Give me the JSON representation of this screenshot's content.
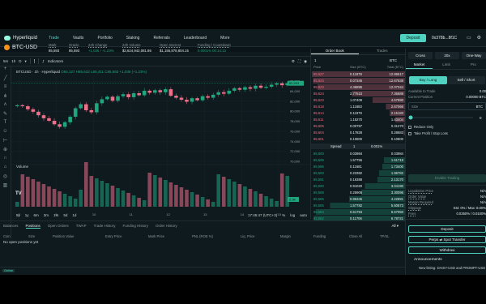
{
  "nav": {
    "logo": "Hyperliquid",
    "links": [
      "Trade",
      "Vaults",
      "Portfolio",
      "Staking",
      "Referrals",
      "Leaderboard",
      "More"
    ],
    "active": "Trade",
    "connect_label": "Deposit",
    "account": "0x378b...8f1C",
    "icons": [
      "display-icon",
      "gear-icon",
      "globe-icon"
    ]
  },
  "ticker": {
    "symbol": "BTC-USD",
    "stats": [
      {
        "label": "Mark",
        "value": "85,593"
      },
      {
        "label": "Oracle",
        "value": "85,593"
      },
      {
        "label": "24h Change",
        "value": "+1,036 / +1.23%"
      },
      {
        "label": "24h Volume",
        "value": "$3,624,942,081.86"
      },
      {
        "label": "Open Interest",
        "value": "$1,155,878,804.15"
      },
      {
        "label": "Funding / Countdown",
        "value": "0.0001%  00:14:13"
      }
    ]
  },
  "chart_toolbar": {
    "intervals": [
      "5m",
      "1h",
      "D"
    ],
    "indicators_label": "Indicators"
  },
  "chart_title": "BTCUSD · 1h · Hyperliquid",
  "chart_ohlc": "O84,127 H85,632 L85,411 C85,593 +1,036 (+1.23%)",
  "volume_label": "Volume",
  "chart_bottom": {
    "ranges": [
      "5y",
      "1y",
      "6m",
      "3m",
      "1m",
      "5d",
      "1d"
    ],
    "time": "17:45:47 (UTC+3)",
    "scale_labels": [
      "%",
      "log",
      "auto"
    ]
  },
  "chart_data": {
    "type": "candlestick",
    "x_ticks": [
      "8",
      "9",
      "10",
      "11",
      "12",
      "13",
      "14",
      "15"
    ],
    "y_ticks": [
      "86,000",
      "84,000",
      "82,000",
      "80,000",
      "78,000",
      "76,000",
      "74,000",
      "72,000",
      "70,000"
    ],
    "last_price_label": "85,593",
    "volume_label_value": "2.3K",
    "y_range": [
      70000,
      87000
    ],
    "close_series": [
      81200,
      81000,
      80400,
      79900,
      79200,
      78600,
      78100,
      77400,
      76900,
      77800,
      78900,
      80600,
      81400,
      80200,
      79800,
      81600,
      82400,
      82900,
      82100,
      83000,
      83400,
      82800,
      83600,
      83200,
      84100,
      83700,
      84200,
      83800,
      84400,
      83100,
      82700,
      82300,
      81900,
      82600,
      82200,
      83000,
      82700,
      83300,
      83800,
      83500,
      84100,
      84600,
      84300,
      84800,
      84500,
      85100,
      84700,
      84900,
      85300,
      85600,
      85200,
      85593
    ]
  },
  "orderbook": {
    "tabs": [
      "Order Book",
      "Trades"
    ],
    "active_tab": "Order Book",
    "tick_size": "1",
    "unit": "BTC",
    "columns": [
      "Price",
      "Size (BTC)",
      "Total (BTC)"
    ],
    "asks": [
      [
        "85,627",
        "0.11879",
        "12.86517"
      ],
      [
        "85,624",
        "0.07345",
        "12.67638"
      ],
      [
        "85,623",
        "4.46895",
        "12.07344"
      ],
      [
        "85,624",
        "2.77510",
        "7.35689"
      ],
      [
        "85,623",
        "1.07409",
        "4.57990"
      ],
      [
        "85,618",
        "1.11883",
        "2.67066"
      ],
      [
        "85,614",
        "0.11979",
        "2.15183"
      ],
      [
        "85,611",
        "1.15270",
        "1.43404"
      ],
      [
        "85,606",
        "0.00797",
        "0.31270"
      ],
      [
        "85,604",
        "0.17828",
        "0.28683"
      ],
      [
        "85,601",
        "0.10800",
        "0.10800"
      ]
    ],
    "spread_label": "Spread",
    "spread_value": "1",
    "spread_pct": "0.001%",
    "bids": [
      [
        "85,600",
        "0.03984",
        "0.03984"
      ],
      [
        "85,599",
        "1.57755",
        "1.61719"
      ],
      [
        "85,596",
        "0.11681",
        "1.73400"
      ],
      [
        "85,593",
        "0.23382",
        "1.96782"
      ],
      [
        "85,591",
        "0.16388",
        "2.13170"
      ],
      [
        "85,590",
        "0.91020",
        "3.04190"
      ],
      [
        "85,588",
        "0.25906",
        "3.30096"
      ],
      [
        "85,586",
        "0.95345",
        "4.22891"
      ],
      [
        "85,585",
        "1.57782",
        "5.60673"
      ],
      [
        "85,584",
        "0.61794",
        "6.67050"
      ],
      [
        "85,582",
        "0.11706",
        "6.78721"
      ]
    ]
  },
  "panel": {
    "margin_modes": [
      "Cross",
      "20x",
      "One-Way"
    ],
    "order_tabs": [
      "Market",
      "Limit",
      "Pro"
    ],
    "active_order_tab": "Market",
    "buy_label": "Buy / Long",
    "sell_label": "Sell / Short",
    "available_label": "Available to Trade",
    "available_value": "0.00",
    "position_label": "Current Position",
    "position_value": "0.00000 BTC",
    "size_label": "Size",
    "size_unit": "BTC",
    "size_pct": "0",
    "reduce_only": "Reduce Only",
    "tpsl": "Take Profit / Stop Loss",
    "enable_label": "Enable Trading",
    "info": [
      {
        "label": "Liquidation Price",
        "value": "N/A"
      },
      {
        "label": "Order Value",
        "value": "N/A"
      },
      {
        "label": "Margin Required",
        "value": "N/A"
      },
      {
        "label": "Slippage",
        "value": "Est: 0% / Max: 8.00%"
      },
      {
        "label": "Fees",
        "value": "0.0350% / 0.0100%"
      }
    ],
    "deposit_label": "Deposit",
    "transfer_label": "Perps ⇄ Spot Transfer",
    "withdraw_label": "Withdraw",
    "announcements_label": "Announcements",
    "announcement_text": "New listing: DAISY-USD and PROMPT-USD perps"
  },
  "bottom": {
    "tabs": [
      "Balances",
      "Positions",
      "Open Orders",
      "TWAP",
      "Trade History",
      "Funding History",
      "Order History"
    ],
    "active_tab": "Positions",
    "filter": "All",
    "columns": [
      "Coin",
      "Size",
      "Position Value",
      "Entry Price",
      "Mark Price",
      "PNL (ROE %)",
      "Liq. Price",
      "Margin",
      "Funding",
      "Close All",
      "TP/SL"
    ],
    "empty_text": "No open positions yet",
    "status": "Online"
  }
}
